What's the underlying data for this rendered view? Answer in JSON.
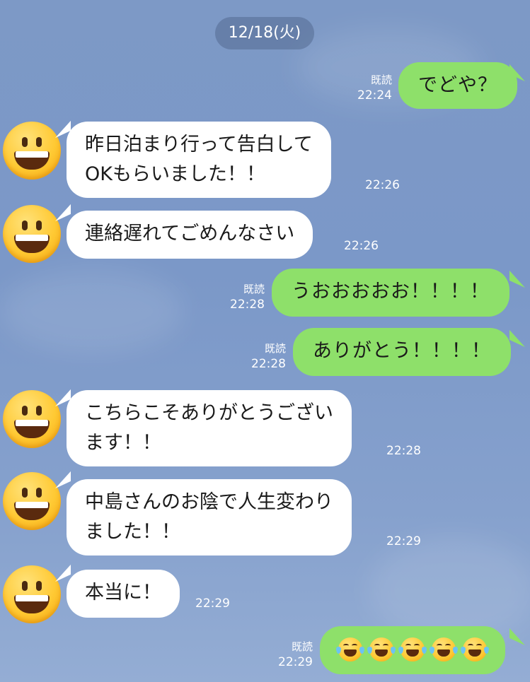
{
  "date_label": "12/18(火)",
  "read_label": "既読",
  "messages": [
    {
      "dir": "out",
      "text": "でどや？",
      "time": "22:24",
      "read": true
    },
    {
      "dir": "in",
      "text": "昨日泊まり行って告白して\nOKもらいました！！",
      "time": "22:26"
    },
    {
      "dir": "in",
      "text": "連絡遅れてごめんなさい",
      "time": "22:26"
    },
    {
      "dir": "out",
      "text": "うおおおおお！！！！",
      "time": "22:28",
      "read": true
    },
    {
      "dir": "out",
      "text": "ありがとう！！！！",
      "time": "22:28",
      "read": true
    },
    {
      "dir": "in",
      "text": "こちらこそありがとうござい\nます！！",
      "time": "22:28"
    },
    {
      "dir": "in",
      "text": "中島さんのお陰で人生変わり\nました！！",
      "time": "22:29"
    },
    {
      "dir": "in",
      "text": "本当に！",
      "time": "22:29"
    },
    {
      "dir": "out",
      "emoji": "face-with-tears-of-joy",
      "emoji_count": 5,
      "time": "22:29",
      "read": true
    }
  ],
  "avatar_icon": "grinning-face-icon",
  "colors": {
    "background": "#7d99c6",
    "outgoing_bubble": "#8ee06a",
    "incoming_bubble": "#ffffff",
    "date_pill": "#4a6390"
  }
}
